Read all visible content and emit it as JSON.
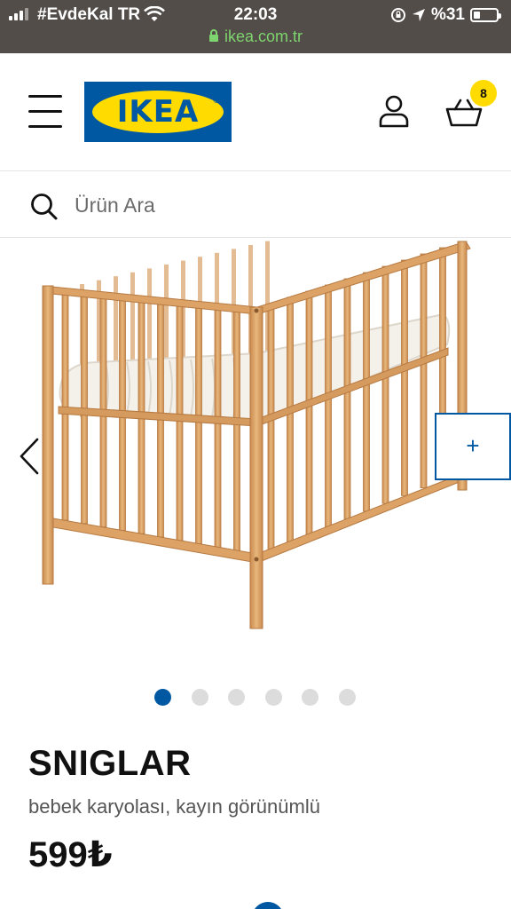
{
  "status_bar": {
    "carrier": "#EvdeKal TR",
    "time": "22:03",
    "battery": "%31",
    "battery_level": 0.31,
    "url": "ikea.com.tr"
  },
  "header": {
    "logo_text": "IKEA",
    "cart_count": "8",
    "brand_colors": {
      "blue": "#0058a3",
      "yellow": "#ffdb00"
    }
  },
  "search": {
    "placeholder": "Ürün Ara"
  },
  "gallery": {
    "zoom_label": "+",
    "image_count": 6,
    "active_index": 0
  },
  "product": {
    "name": "SNIGLAR",
    "description": "bebek karyolası, kayın görünümlü",
    "price": "599₺"
  }
}
